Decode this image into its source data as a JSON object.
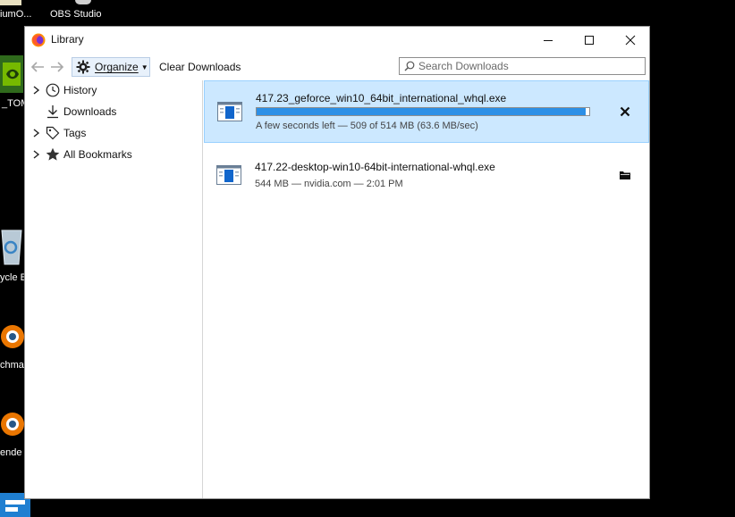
{
  "desktop": {
    "icons": [
      {
        "label": "iumO...",
        "icon": "app-icon"
      },
      {
        "label": "OBS Studio",
        "icon": "obs-icon"
      },
      {
        "label": "_TOM",
        "icon": "nvidia-icon"
      },
      {
        "label": "ycle B",
        "icon": "recycle-bin-icon"
      },
      {
        "label": "chma",
        "icon": "blender-icon"
      },
      {
        "label": "ende",
        "icon": "blender-icon"
      }
    ]
  },
  "window": {
    "title": "Library",
    "controls": {
      "minimize": "minimize-icon",
      "maximize": "maximize-icon",
      "close": "close-icon"
    }
  },
  "toolbar": {
    "organize_label": "Organize",
    "clear_label": "Clear Downloads",
    "search_placeholder": "Search Downloads"
  },
  "sidebar": {
    "items": [
      {
        "label": "History",
        "icon": "clock-icon",
        "expandable": true
      },
      {
        "label": "Downloads",
        "icon": "download-arrow-icon",
        "expandable": false
      },
      {
        "label": "Tags",
        "icon": "tag-icon",
        "expandable": true
      },
      {
        "label": "All Bookmarks",
        "icon": "star-icon",
        "expandable": true
      }
    ]
  },
  "downloads": [
    {
      "name": "417.23_geforce_win10_64bit_international_whql.exe",
      "status": "A few seconds left — 509 of 514 MB (63.6 MB/sec)",
      "progress": 0.99,
      "action": "cancel-icon"
    },
    {
      "name": "417.22-desktop-win10-64bit-international-whql.exe",
      "status": "544 MB — nvidia.com — 2:01 PM",
      "action": "folder-icon"
    }
  ],
  "colors": {
    "selected_bg": "#cce8ff",
    "selected_border": "#99d1ff",
    "progress_fill": "#2c8fe6",
    "desktop_bg": "#000000"
  }
}
